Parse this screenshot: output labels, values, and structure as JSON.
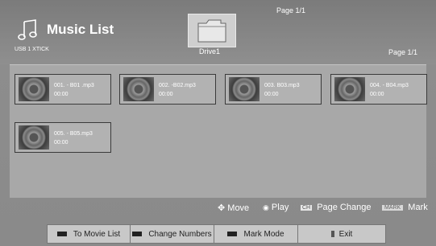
{
  "header": {
    "title": "Music List",
    "device": "USB 1 XTICK",
    "drive": "Drive1",
    "page_top": "Page 1/1",
    "page_right": "Page 1/1",
    "icon": "music-note-icon",
    "folder_icon": "folder-icon"
  },
  "files": [
    {
      "name": "001. - B01 .mp3",
      "duration": "00:00"
    },
    {
      "name": "002. -B02.mp3",
      "duration": "00:00"
    },
    {
      "name": "003. B03.mp3",
      "duration": "00:00"
    },
    {
      "name": "004. - B04.mp3",
      "duration": "00:00"
    },
    {
      "name": "005. - B05.mp3",
      "duration": "00:00"
    }
  ],
  "hints": {
    "move": "Move",
    "play": "Play",
    "ch_key": "CH",
    "page_change": "Page Change",
    "mark_key": "MARK",
    "mark": "Mark"
  },
  "buttons": {
    "movie_list": "To Movie List",
    "change_numbers": "Change Numbers",
    "mark_mode": "Mark Mode",
    "exit": "Exit"
  },
  "colors": {
    "background": "#8a8a8a",
    "panel": "#a8a8a8",
    "text": "#ffffff"
  }
}
